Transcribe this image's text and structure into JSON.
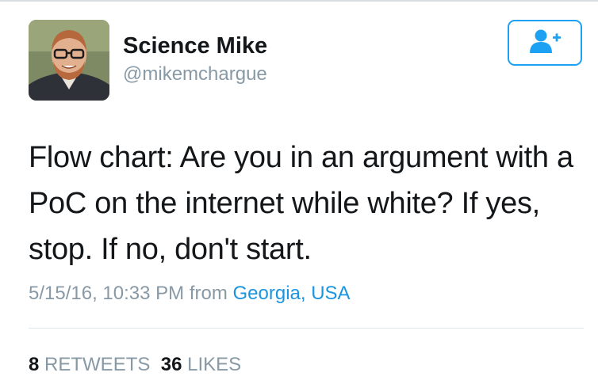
{
  "user": {
    "display_name": "Science Mike",
    "handle": "@mikemchargue",
    "avatar_icon": "profile-photo"
  },
  "follow_button": {
    "icon": "add-user-icon",
    "color": "#1da1f2"
  },
  "tweet": {
    "text": "Flow chart: Are you in an argument with a PoC on the internet while white? If yes, stop. If no, don't start.",
    "timestamp": "5/15/16, 10:33 PM",
    "from_label": "from",
    "location": "Georgia, USA"
  },
  "stats": {
    "retweets_count": "8",
    "retweets_label": "RETWEETS",
    "likes_count": "36",
    "likes_label": "LIKES"
  },
  "colors": {
    "text": "#14171a",
    "muted": "#8899a6",
    "link": "#1b95e0",
    "divider": "#e1e8ed"
  }
}
